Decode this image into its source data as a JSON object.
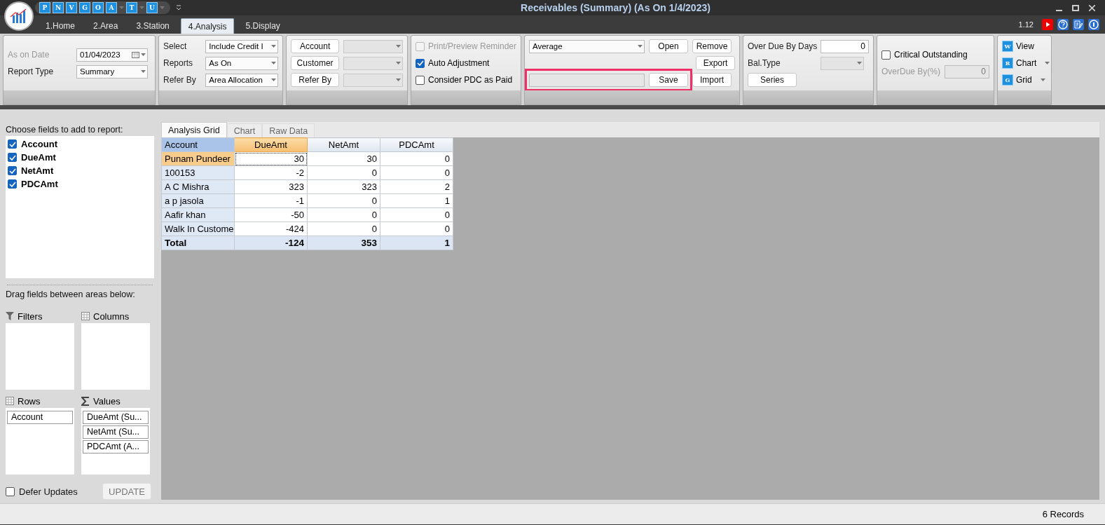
{
  "window": {
    "title": "Receivables (Summary) (As On 1/4/2023)"
  },
  "quick_access": [
    {
      "label": "P",
      "dropdown": false
    },
    {
      "label": "N",
      "dropdown": false
    },
    {
      "label": "V",
      "dropdown": false
    },
    {
      "label": "G",
      "dropdown": false
    },
    {
      "label": "O",
      "dropdown": false
    },
    {
      "label": "A",
      "dropdown": true
    },
    {
      "label": "T",
      "dropdown": true
    },
    {
      "label": "U",
      "dropdown": true
    }
  ],
  "tabs": [
    {
      "label": "1.Home",
      "selected": false
    },
    {
      "label": "2.Area",
      "selected": false
    },
    {
      "label": "3.Station",
      "selected": false
    },
    {
      "label": "4.Analysis",
      "selected": true
    },
    {
      "label": "5.Display",
      "selected": false
    }
  ],
  "version": "1.12",
  "ribbon": [
    {
      "kind": "form",
      "rows": [
        [
          {
            "kind": "label",
            "text": "As on Date",
            "disabled": true
          },
          {
            "kind": "date",
            "value": "01/04/2023",
            "disabled": false
          }
        ],
        [
          {
            "kind": "label",
            "text": "Report Type",
            "disabled": false
          },
          {
            "kind": "combo",
            "value": "Summary",
            "disabled": false
          }
        ]
      ]
    },
    {
      "kind": "form",
      "rows": [
        [
          {
            "kind": "label",
            "text": "Select",
            "disabled": false
          },
          {
            "kind": "combo",
            "value": "Include Credit I",
            "disabled": false
          }
        ],
        [
          {
            "kind": "label",
            "text": "Reports",
            "disabled": false
          },
          {
            "kind": "combo",
            "value": "As On",
            "disabled": false
          }
        ],
        [
          {
            "kind": "label",
            "text": "Refer By",
            "disabled": false
          },
          {
            "kind": "combo",
            "value": "Area Allocation",
            "disabled": false
          }
        ]
      ]
    },
    {
      "kind": "form",
      "rows": [
        [
          {
            "kind": "button",
            "text": "Account"
          },
          {
            "kind": "combo",
            "disabled": true
          }
        ],
        [
          {
            "kind": "button",
            "text": "Customer"
          },
          {
            "kind": "combo",
            "disabled": true
          }
        ],
        [
          {
            "kind": "button",
            "text": "Refer By"
          },
          {
            "kind": "combo",
            "disabled": true
          }
        ]
      ]
    },
    {
      "kind": "form",
      "rows": [
        [
          {
            "kind": "check",
            "text": "Print/Preview Reminder",
            "checked": false,
            "disabled": true
          }
        ],
        [
          {
            "kind": "check",
            "text": "Auto Adjustment",
            "checked": true,
            "disabled": false
          }
        ],
        [
          {
            "kind": "check",
            "text": "Consider PDC as Paid",
            "checked": false,
            "disabled": false
          }
        ]
      ]
    },
    {
      "kind": "file",
      "rows": [
        [
          {
            "kind": "combo",
            "value": "Average",
            "disabled": false
          },
          {
            "kind": "button",
            "text": "Open"
          },
          {
            "kind": "button",
            "text": "Remove"
          }
        ],
        [
          "",
          "",
          {
            "kind": "button",
            "text": "Export"
          }
        ],
        [
          {
            "kind": "field",
            "disabled": true,
            "highlighted": true
          },
          {
            "kind": "button",
            "text": "Save",
            "highlighted": true
          },
          {
            "kind": "button",
            "text": "Import",
            "highlighted": false
          }
        ]
      ]
    },
    {
      "kind": "form",
      "rows": [
        [
          {
            "kind": "label",
            "text": "Over Due By Days",
            "disabled": false
          },
          {
            "kind": "field",
            "value": "0",
            "disabled": false
          }
        ],
        [
          {
            "kind": "label",
            "text": "Bal.Type",
            "disabled": false
          },
          {
            "kind": "combo",
            "disabled": true
          }
        ],
        [
          {
            "kind": "button",
            "text": "Series"
          }
        ]
      ]
    },
    {
      "kind": "form",
      "rows": [
        [
          {
            "kind": "check",
            "text": "Critical Outstanding",
            "checked": false,
            "disabled": false
          }
        ],
        [
          {
            "kind": "label",
            "text": "OverDue By(%)",
            "disabled": true
          },
          {
            "kind": "field",
            "value": "0",
            "disabled": true
          }
        ]
      ]
    },
    {
      "kind": "menu",
      "rows": [
        [
          {
            "kind": "menu",
            "icon": "W",
            "text": "View",
            "dropdown": false
          }
        ],
        [
          {
            "kind": "menu",
            "icon": "R",
            "text": "Chart",
            "dropdown": true
          }
        ],
        [
          {
            "kind": "menu",
            "icon": "G",
            "text": "Grid",
            "dropdown": true
          }
        ]
      ]
    }
  ],
  "field_list": {
    "title": "Choose fields to add to report:",
    "fields": [
      {
        "label": "Account",
        "checked": true
      },
      {
        "label": "DueAmt",
        "checked": true
      },
      {
        "label": "NetAmt",
        "checked": true
      },
      {
        "label": "PDCAmt",
        "checked": true
      }
    ],
    "areas_title": "Drag fields between areas below:",
    "areas": [
      {
        "kind": "filters",
        "label": "Filters"
      },
      {
        "kind": "columns",
        "label": "Columns"
      },
      {
        "kind": "rows",
        "label": "Rows",
        "items": [
          "Account"
        ]
      },
      {
        "kind": "values",
        "label": "Values",
        "items": [
          "DueAmt (Su...",
          "NetAmt (Su...",
          "PDCAmt (A..."
        ]
      }
    ],
    "defer_updates": {
      "label": "Defer Updates",
      "checked": false
    },
    "update_button": "UPDATE"
  },
  "view_tabs": [
    {
      "label": "Analysis Grid",
      "selected": true
    },
    {
      "label": "Chart",
      "selected": false
    },
    {
      "label": "Raw Data",
      "selected": false
    }
  ],
  "table": {
    "columns": [
      {
        "label": "Account",
        "selected": false
      },
      {
        "label": "DueAmt",
        "selected": true
      },
      {
        "label": "NetAmt",
        "selected": false
      },
      {
        "label": "PDCAmt",
        "selected": false
      }
    ],
    "rows": [
      {
        "account": "Punam Pundeer",
        "due": "30",
        "net": "30",
        "pdc": "0",
        "selected": true
      },
      {
        "account": "100153",
        "due": "-2",
        "net": "0",
        "pdc": "0",
        "selected": false
      },
      {
        "account": "A C Mishra",
        "due": "323",
        "net": "323",
        "pdc": "2",
        "selected": false
      },
      {
        "account": "a p jasola",
        "due": "-1",
        "net": "0",
        "pdc": "1",
        "selected": false
      },
      {
        "account": "Aafir khan",
        "due": "-50",
        "net": "0",
        "pdc": "0",
        "selected": false
      },
      {
        "account": "Walk In Custome",
        "due": "-424",
        "net": "0",
        "pdc": "0",
        "selected": false
      }
    ],
    "total": {
      "account": "Total",
      "due": "-124",
      "net": "353",
      "pdc": "1"
    }
  },
  "status_bar": {
    "records": "6 Records"
  }
}
